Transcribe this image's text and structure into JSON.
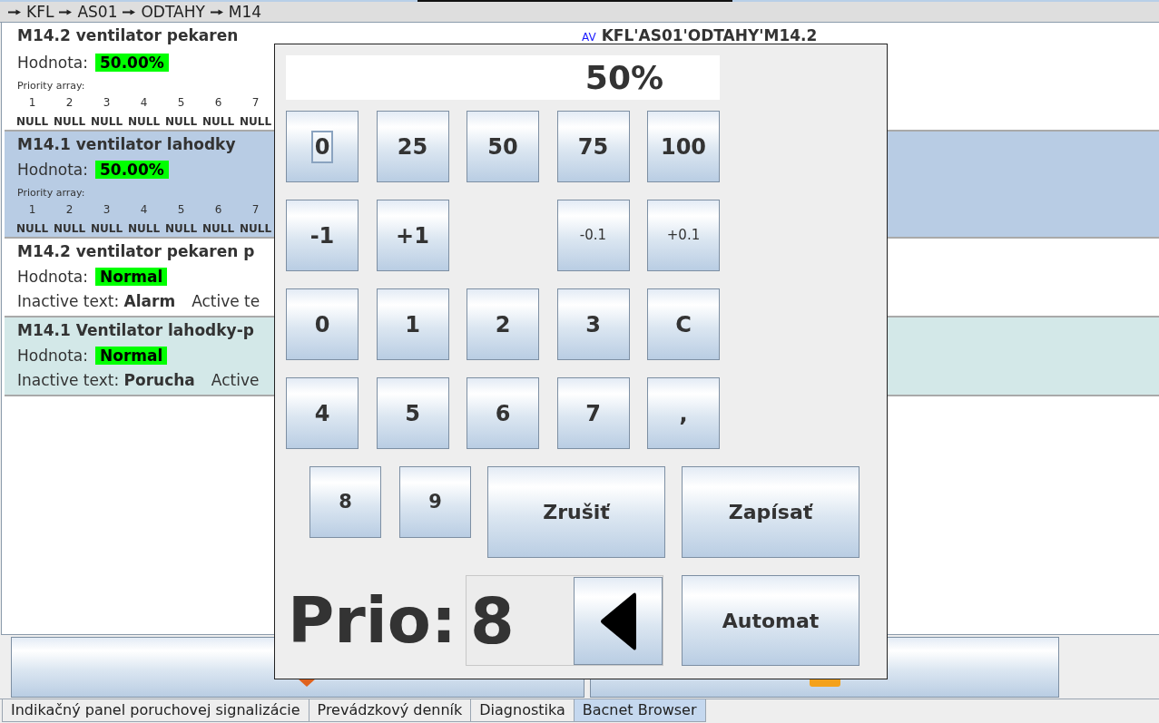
{
  "breadcrumb": [
    "KFL",
    "AS01",
    "ODTAHY",
    "M14"
  ],
  "objects": [
    {
      "kind": "analog",
      "selected": false,
      "title": "M14.2 ventilator pekaren",
      "type_tag": "AV",
      "path": "KFL'AS01'ODTAHY'M14.2",
      "value_label": "Hodnota:",
      "value": "50.00%",
      "priority_label": "Priority array:",
      "priority": [
        {
          "index": "1",
          "value": "NULL"
        },
        {
          "index": "2",
          "value": "NULL"
        },
        {
          "index": "3",
          "value": "NULL"
        },
        {
          "index": "4",
          "value": "NULL"
        },
        {
          "index": "5",
          "value": "NULL"
        },
        {
          "index": "6",
          "value": "NULL"
        },
        {
          "index": "7",
          "value": "NULL"
        }
      ]
    },
    {
      "kind": "analog",
      "selected": true,
      "title": "M14.1 ventilator lahodky",
      "value_label": "Hodnota:",
      "value": "50.00%",
      "priority_label": "Priority array:",
      "priority": [
        {
          "index": "1",
          "value": "NULL"
        },
        {
          "index": "2",
          "value": "NULL"
        },
        {
          "index": "3",
          "value": "NULL"
        },
        {
          "index": "4",
          "value": "NULL"
        },
        {
          "index": "5",
          "value": "NULL"
        },
        {
          "index": "6",
          "value": "NULL"
        },
        {
          "index": "7",
          "value": "NULL"
        }
      ]
    },
    {
      "kind": "binary",
      "selected": false,
      "title": "M14.2 ventilator pekaren p",
      "value_label": "Hodnota:",
      "value": "Normal",
      "inactive_text": "Inactive text: **Alarm**",
      "active_text": "Active te"
    },
    {
      "kind": "binary",
      "selected": false,
      "color": "#d3e8e8",
      "title": "M14.1 Ventilator lahodky-p",
      "value_label": "Hodnota:",
      "value": "Normal",
      "inactive_text": "Inactive text: **Porucha**",
      "active_text": "Active"
    }
  ],
  "value_dialog": {
    "display": "50%",
    "keypad": [
      [
        {
          "kind": "key",
          "label": "0",
          "focused": true
        },
        {
          "kind": "key",
          "label": "25",
          "focused": false
        },
        {
          "kind": "key",
          "label": "50",
          "focused": false
        },
        {
          "kind": "key",
          "label": "75",
          "focused": false
        },
        {
          "kind": "key",
          "label": "100",
          "focused": false
        }
      ],
      [
        {
          "kind": "key",
          "label": "-1",
          "focused": false
        },
        {
          "kind": "key",
          "label": "+1",
          "focused": false
        },
        {
          "kind": "gap"
        },
        {
          "kind": "fine",
          "label": "-0.1",
          "focused": false
        },
        {
          "kind": "fine",
          "label": "+0.1",
          "focused": false
        }
      ],
      [
        {
          "kind": "key",
          "label": "0",
          "focused": false
        },
        {
          "kind": "key",
          "label": "1",
          "focused": false
        },
        {
          "kind": "key",
          "label": "2",
          "focused": false
        },
        {
          "kind": "key",
          "label": "3",
          "focused": false
        },
        {
          "kind": "key",
          "label": "C",
          "focused": false
        }
      ],
      [
        {
          "kind": "key",
          "label": "4",
          "focused": false
        },
        {
          "kind": "key",
          "label": "5",
          "focused": false
        },
        {
          "kind": "key",
          "label": "6",
          "focused": false
        },
        {
          "kind": "key",
          "label": "7",
          "focused": false
        },
        {
          "kind": "key",
          "label": ",",
          "focused": false
        }
      ]
    ],
    "small_keys": [
      {
        "label": "8",
        "focused": false
      },
      {
        "label": "9",
        "focused": false
      }
    ],
    "cancel_button": "Zrušiť",
    "write_button": "Zapísať",
    "priority_label": "Prio:",
    "priority_value": "8",
    "auto_button": "Automat"
  },
  "tabs": [
    {
      "label": "Indikačný panel poruchovej signalizácie",
      "selected": false
    },
    {
      "label": "Prevádzkový denník",
      "selected": false
    },
    {
      "label": "Diagnostika",
      "selected": false
    },
    {
      "label": "Bacnet Browser",
      "selected": true
    }
  ]
}
